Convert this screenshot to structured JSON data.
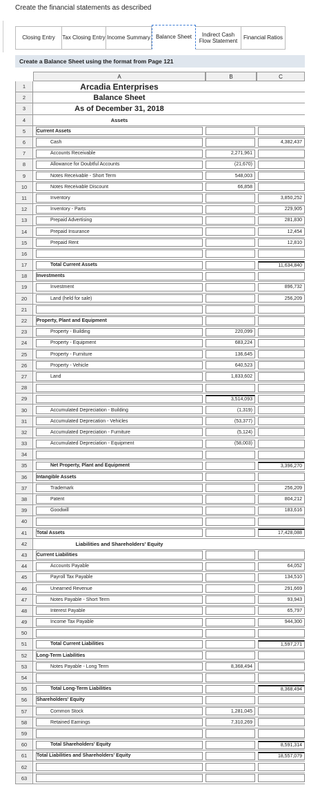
{
  "instruction": "Create the financial statements as described",
  "tabs": [
    {
      "label": "Closing Entry",
      "active": false
    },
    {
      "label": "Tax Closing Entry",
      "active": false
    },
    {
      "label": "Income Summary",
      "active": false
    },
    {
      "label": "Balance Sheet",
      "active": true
    },
    {
      "label": "Indirect Cash Flow Statement",
      "active": false
    },
    {
      "label": "Financial Ratios",
      "active": false
    }
  ],
  "section_title": "Create a Balance Sheet using the format from Page 121",
  "columns": [
    "A",
    "B",
    "C"
  ],
  "rows": [
    {
      "n": "1",
      "a": "Arcadia Enterprises",
      "style": "title1"
    },
    {
      "n": "2",
      "a": "Balance Sheet",
      "style": "title2"
    },
    {
      "n": "3",
      "a": "As of December 31, 2018",
      "style": "title2"
    },
    {
      "n": "4",
      "a": "Assets",
      "style": "title3"
    },
    {
      "n": "5",
      "a": "Current Assets",
      "style": "bold"
    },
    {
      "n": "6",
      "a": "Cash",
      "style": "ind2",
      "c": "4,382,437"
    },
    {
      "n": "7",
      "a": "Accounts Receivable",
      "style": "ind2",
      "b": "2,271,961"
    },
    {
      "n": "8",
      "a": "Allowance for Doubtful Accounts",
      "style": "ind2",
      "b": "(21,670)"
    },
    {
      "n": "9",
      "a": "Notes Receivable - Short Term",
      "style": "ind2",
      "b": "548,003"
    },
    {
      "n": "10",
      "a": "Notes Receivable Discount",
      "style": "ind2",
      "b": "66,858"
    },
    {
      "n": "11",
      "a": "Inventory",
      "style": "ind2",
      "c": "3,850,252"
    },
    {
      "n": "12",
      "a": "Inventory - Parts",
      "style": "ind2",
      "c": "229,905"
    },
    {
      "n": "13",
      "a": "Prepaid Advertising",
      "style": "ind2",
      "c": "281,830"
    },
    {
      "n": "14",
      "a": "Prepaid Insurance",
      "style": "ind2",
      "c": "12,454"
    },
    {
      "n": "15",
      "a": "Prepaid Rent",
      "style": "ind2",
      "c": "12,810"
    },
    {
      "n": "16",
      "a": "",
      "style": ""
    },
    {
      "n": "17",
      "a": "Total Current Assets",
      "style": "bold ind2",
      "c": "11,634,840"
    },
    {
      "n": "18",
      "a": "Investments",
      "style": "bold"
    },
    {
      "n": "19",
      "a": "Investment",
      "style": "ind2",
      "c": "896,732"
    },
    {
      "n": "20",
      "a": "Land (held for sale)",
      "style": "ind2",
      "c": "256,209"
    },
    {
      "n": "21",
      "a": "",
      "style": ""
    },
    {
      "n": "22",
      "a": "Property, Plant and Equipment",
      "style": "bold"
    },
    {
      "n": "23",
      "a": "Property - Building",
      "style": "ind2",
      "b": "220,099"
    },
    {
      "n": "24",
      "a": "Property - Equipment",
      "style": "ind2",
      "b": "683,224"
    },
    {
      "n": "25",
      "a": "Property - Furniture",
      "style": "ind2",
      "b": "136,645"
    },
    {
      "n": "26",
      "a": "Property - Vehicle",
      "style": "ind2",
      "b": "640,523"
    },
    {
      "n": "27",
      "a": "Land",
      "style": "ind2",
      "b": "1,833,602"
    },
    {
      "n": "28",
      "a": "",
      "style": ""
    },
    {
      "n": "29",
      "a": "",
      "style": "",
      "b": "3,514,093"
    },
    {
      "n": "30",
      "a": "Accumulated Depreciation - Building",
      "style": "ind2",
      "b": "(1,319)"
    },
    {
      "n": "31",
      "a": "Accumulated Deprecation - Vehicles",
      "style": "ind2",
      "b": "(53,377)"
    },
    {
      "n": "32",
      "a": "Accumulated Depreciation - Furniture",
      "style": "ind2",
      "b": "(5,124)"
    },
    {
      "n": "33",
      "a": "Accumulated Depreciation - Equipment",
      "style": "ind2",
      "b": "(58,003)"
    },
    {
      "n": "34",
      "a": "",
      "style": ""
    },
    {
      "n": "35",
      "a": "Net Property, Plant and Equipment",
      "style": "bold ind2",
      "c": "3,396,270"
    },
    {
      "n": "36",
      "a": "Intangible Assets",
      "style": "bold"
    },
    {
      "n": "37",
      "a": "Trademark",
      "style": "ind2",
      "c": "256,209"
    },
    {
      "n": "38",
      "a": "Patent",
      "style": "ind2",
      "c": "804,212"
    },
    {
      "n": "39",
      "a": "Goodwill",
      "style": "ind2",
      "c": "183,616"
    },
    {
      "n": "40",
      "a": "",
      "style": ""
    },
    {
      "n": "41",
      "a": "Total Assets",
      "style": "bold",
      "c": "17,428,088"
    },
    {
      "n": "42",
      "a": "Liabilities and Shareholders' Equity",
      "style": "title3"
    },
    {
      "n": "43",
      "a": "Current Liabilities",
      "style": "bold"
    },
    {
      "n": "44",
      "a": "Accounts Payable",
      "style": "ind2",
      "c": "64,052"
    },
    {
      "n": "45",
      "a": "Payroll Tax Payable",
      "style": "ind2",
      "c": "134,510"
    },
    {
      "n": "46",
      "a": "Unearned Revenue",
      "style": "ind2",
      "c": "291,669"
    },
    {
      "n": "47",
      "a": "Notes Payable - Short Term",
      "style": "ind2",
      "c": "93,943"
    },
    {
      "n": "48",
      "a": "Interest Payable",
      "style": "ind2",
      "c": "65,797"
    },
    {
      "n": "49",
      "a": "Income Tax Payable",
      "style": "ind2",
      "c": "944,300"
    },
    {
      "n": "50",
      "a": "",
      "style": ""
    },
    {
      "n": "51",
      "a": "Total Current Liabilities",
      "style": "bold ind2",
      "c": "1,597,271"
    },
    {
      "n": "52",
      "a": "Long-Term Liabilities",
      "style": "bold"
    },
    {
      "n": "53",
      "a": "Notes Payable - Long Term",
      "style": "ind2",
      "b": "8,368,494"
    },
    {
      "n": "54",
      "a": "",
      "style": ""
    },
    {
      "n": "55",
      "a": "Total Long-Term Liabilities",
      "style": "bold ind2",
      "c": "8,368,494"
    },
    {
      "n": "56",
      "a": "Shareholders' Equity",
      "style": "bold"
    },
    {
      "n": "57",
      "a": "Common Stock",
      "style": "ind2",
      "b": "1,281,045"
    },
    {
      "n": "58",
      "a": "Retained Earnings",
      "style": "ind2",
      "b": "7,310,269"
    },
    {
      "n": "59",
      "a": "",
      "style": ""
    },
    {
      "n": "60",
      "a": "Total Shareholders' Equity",
      "style": "bold ind2",
      "c": "8,591,314"
    },
    {
      "n": "61",
      "a": "Total Liabilities and Shareholders' Equity",
      "style": "bold",
      "c": "18,557,079"
    },
    {
      "n": "62",
      "a": "",
      "style": ""
    },
    {
      "n": "63",
      "a": "",
      "style": ""
    }
  ]
}
